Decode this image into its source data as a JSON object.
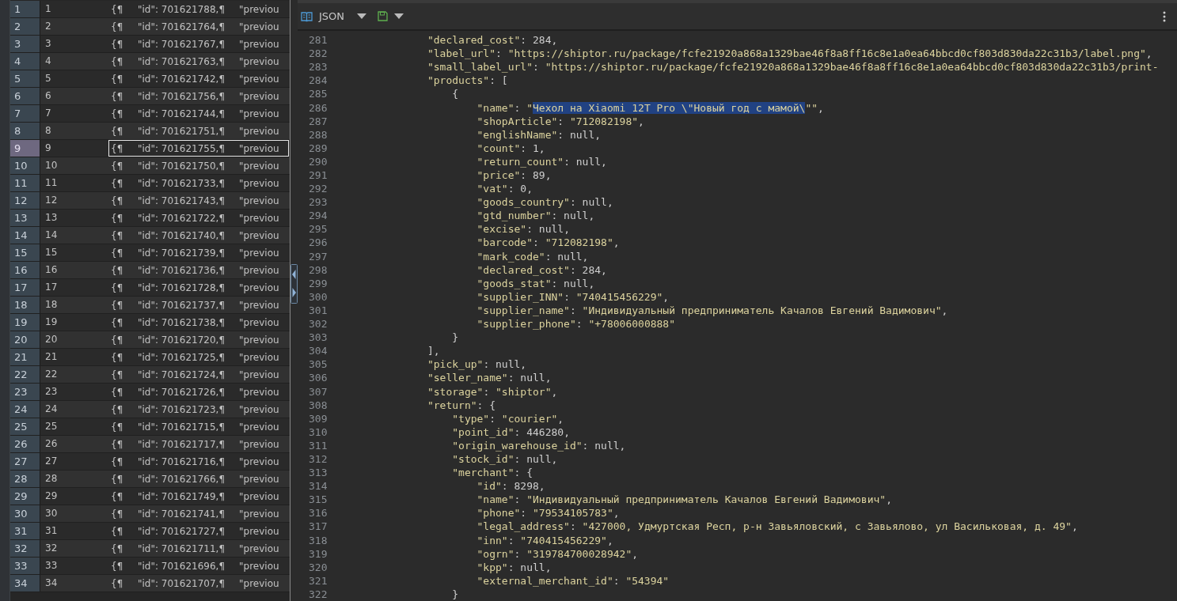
{
  "table": {
    "rows": [
      {
        "header": "1",
        "cells": [
          "1",
          "{¶",
          "\"id\": 701621788,¶",
          "\"previou"
        ],
        "selected": false
      },
      {
        "header": "2",
        "cells": [
          "2",
          "{¶",
          "\"id\": 701621764,¶",
          "\"previou"
        ],
        "selected": false
      },
      {
        "header": "3",
        "cells": [
          "3",
          "{¶",
          "\"id\": 701621767,¶",
          "\"previou"
        ],
        "selected": false
      },
      {
        "header": "4",
        "cells": [
          "4",
          "{¶",
          "\"id\": 701621763,¶",
          "\"previou"
        ],
        "selected": false
      },
      {
        "header": "5",
        "cells": [
          "5",
          "{¶",
          "\"id\": 701621742,¶",
          "\"previou"
        ],
        "selected": false
      },
      {
        "header": "6",
        "cells": [
          "6",
          "{¶",
          "\"id\": 701621756,¶",
          "\"previou"
        ],
        "selected": false
      },
      {
        "header": "7",
        "cells": [
          "7",
          "{¶",
          "\"id\": 701621744,¶",
          "\"previou"
        ],
        "selected": false
      },
      {
        "header": "8",
        "cells": [
          "8",
          "{¶",
          "\"id\": 701621751,¶",
          "\"previou"
        ],
        "selected": false
      },
      {
        "header": "9",
        "cells": [
          "9",
          "{¶",
          "\"id\": 701621755,¶",
          "\"previou"
        ],
        "selected": true
      },
      {
        "header": "10",
        "cells": [
          "10",
          "{¶",
          "\"id\": 701621750,¶",
          "\"previou"
        ],
        "selected": false
      },
      {
        "header": "11",
        "cells": [
          "11",
          "{¶",
          "\"id\": 701621733,¶",
          "\"previou"
        ],
        "selected": false
      },
      {
        "header": "12",
        "cells": [
          "12",
          "{¶",
          "\"id\": 701621743,¶",
          "\"previou"
        ],
        "selected": false
      },
      {
        "header": "13",
        "cells": [
          "13",
          "{¶",
          "\"id\": 701621722,¶",
          "\"previou"
        ],
        "selected": false
      },
      {
        "header": "14",
        "cells": [
          "14",
          "{¶",
          "\"id\": 701621740,¶",
          "\"previou"
        ],
        "selected": false
      },
      {
        "header": "15",
        "cells": [
          "15",
          "{¶",
          "\"id\": 701621739,¶",
          "\"previou"
        ],
        "selected": false
      },
      {
        "header": "16",
        "cells": [
          "16",
          "{¶",
          "\"id\": 701621736,¶",
          "\"previou"
        ],
        "selected": false
      },
      {
        "header": "17",
        "cells": [
          "17",
          "{¶",
          "\"id\": 701621728,¶",
          "\"previou"
        ],
        "selected": false
      },
      {
        "header": "18",
        "cells": [
          "18",
          "{¶",
          "\"id\": 701621737,¶",
          "\"previou"
        ],
        "selected": false
      },
      {
        "header": "19",
        "cells": [
          "19",
          "{¶",
          "\"id\": 701621738,¶",
          "\"previou"
        ],
        "selected": false
      },
      {
        "header": "20",
        "cells": [
          "20",
          "{¶",
          "\"id\": 701621720,¶",
          "\"previou"
        ],
        "selected": false
      },
      {
        "header": "21",
        "cells": [
          "21",
          "{¶",
          "\"id\": 701621725,¶",
          "\"previou"
        ],
        "selected": false
      },
      {
        "header": "22",
        "cells": [
          "22",
          "{¶",
          "\"id\": 701621724,¶",
          "\"previou"
        ],
        "selected": false
      },
      {
        "header": "23",
        "cells": [
          "23",
          "{¶",
          "\"id\": 701621726,¶",
          "\"previou"
        ],
        "selected": false
      },
      {
        "header": "24",
        "cells": [
          "24",
          "{¶",
          "\"id\": 701621723,¶",
          "\"previou"
        ],
        "selected": false
      },
      {
        "header": "25",
        "cells": [
          "25",
          "{¶",
          "\"id\": 701621715,¶",
          "\"previou"
        ],
        "selected": false
      },
      {
        "header": "26",
        "cells": [
          "26",
          "{¶",
          "\"id\": 701621717,¶",
          "\"previou"
        ],
        "selected": false
      },
      {
        "header": "27",
        "cells": [
          "27",
          "{¶",
          "\"id\": 701621716,¶",
          "\"previou"
        ],
        "selected": false
      },
      {
        "header": "28",
        "cells": [
          "28",
          "{¶",
          "\"id\": 701621766,¶",
          "\"previou"
        ],
        "selected": false
      },
      {
        "header": "29",
        "cells": [
          "29",
          "{¶",
          "\"id\": 701621749,¶",
          "\"previou"
        ],
        "selected": false
      },
      {
        "header": "30",
        "cells": [
          "30",
          "{¶",
          "\"id\": 701621741,¶",
          "\"previou"
        ],
        "selected": false
      },
      {
        "header": "31",
        "cells": [
          "31",
          "{¶",
          "\"id\": 701621727,¶",
          "\"previou"
        ],
        "selected": false
      },
      {
        "header": "32",
        "cells": [
          "32",
          "{¶",
          "\"id\": 701621711,¶",
          "\"previou"
        ],
        "selected": false
      },
      {
        "header": "33",
        "cells": [
          "33",
          "{¶",
          "\"id\": 701621696,¶",
          "\"previou"
        ],
        "selected": false
      },
      {
        "header": "34",
        "cells": [
          "34",
          "{¶",
          "\"id\": 701621707,¶",
          "\"previou"
        ],
        "selected": false
      }
    ]
  },
  "editor": {
    "toolbar": {
      "format": "JSON"
    },
    "lines": [
      {
        "number": "281",
        "text": "            \"declared_cost\": 284,"
      },
      {
        "number": "282",
        "text": "            \"label_url\": \"https://shiptor.ru/package/fcfe21920a868a1329bae46f8a8ff16c8e1a0ea64bbcd0cf803d830da22c31b3/label.png\","
      },
      {
        "number": "283",
        "text": "            \"small_label_url\": \"https://shiptor.ru/package/fcfe21920a868a1329bae46f8a8ff16c8e1a0ea64bbcd0cf803d830da22c31b3/print-"
      },
      {
        "number": "284",
        "text": "            \"products\": ["
      },
      {
        "number": "285",
        "text": "                {"
      },
      {
        "number": "286",
        "segments": [
          {
            "text": "                    \"name\": \"",
            "selected": false
          },
          {
            "text": "Чехол на Xiaomi 12T Pro \\\"Новый год с мамой\\",
            "selected": true
          },
          {
            "text": "\"\",",
            "selected": false
          }
        ]
      },
      {
        "number": "287",
        "text": "                    \"shopArticle\": \"712082198\","
      },
      {
        "number": "288",
        "text": "                    \"englishName\": null,"
      },
      {
        "number": "289",
        "text": "                    \"count\": 1,"
      },
      {
        "number": "290",
        "text": "                    \"return_count\": null,"
      },
      {
        "number": "291",
        "text": "                    \"price\": 89,"
      },
      {
        "number": "292",
        "text": "                    \"vat\": 0,"
      },
      {
        "number": "293",
        "text": "                    \"goods_country\": null,"
      },
      {
        "number": "294",
        "text": "                    \"gtd_number\": null,"
      },
      {
        "number": "295",
        "text": "                    \"excise\": null,"
      },
      {
        "number": "296",
        "text": "                    \"barcode\": \"712082198\","
      },
      {
        "number": "297",
        "text": "                    \"mark_code\": null,"
      },
      {
        "number": "298",
        "text": "                    \"declared_cost\": 284,"
      },
      {
        "number": "299",
        "text": "                    \"goods_stat\": null,"
      },
      {
        "number": "300",
        "text": "                    \"supplier_INN\": \"740415456229\","
      },
      {
        "number": "301",
        "text": "                    \"supplier_name\": \"Индивидуальный предприниматель Качалов Евгений Вадимович\","
      },
      {
        "number": "302",
        "text": "                    \"supplier_phone\": \"+78006000888\""
      },
      {
        "number": "303",
        "text": "                }"
      },
      {
        "number": "304",
        "text": "            ],"
      },
      {
        "number": "305",
        "text": "            \"pick_up\": null,"
      },
      {
        "number": "306",
        "text": "            \"seller_name\": null,"
      },
      {
        "number": "307",
        "text": "            \"storage\": \"shiptor\","
      },
      {
        "number": "308",
        "text": "            \"return\": {"
      },
      {
        "number": "309",
        "text": "                \"type\": \"courier\","
      },
      {
        "number": "310",
        "text": "                \"point_id\": 446280,"
      },
      {
        "number": "311",
        "text": "                \"origin_warehouse_id\": null,"
      },
      {
        "number": "312",
        "text": "                \"stock_id\": null,"
      },
      {
        "number": "313",
        "text": "                \"merchant\": {"
      },
      {
        "number": "314",
        "text": "                    \"id\": 8298,"
      },
      {
        "number": "315",
        "text": "                    \"name\": \"Индивидуальный предприниматель Качалов Евгений Вадимович\","
      },
      {
        "number": "316",
        "text": "                    \"phone\": \"79534105783\","
      },
      {
        "number": "317",
        "text": "                    \"legal_address\": \"427000, Удмуртская Респ, р-н Завьяловский, с Завьялово, ул Васильковая, д. 49\","
      },
      {
        "number": "318",
        "text": "                    \"inn\": \"740415456229\","
      },
      {
        "number": "319",
        "text": "                    \"ogrn\": \"319784700028942\","
      },
      {
        "number": "320",
        "text": "                    \"kpp\": null,"
      },
      {
        "number": "321",
        "text": "                    \"external_merchant_id\": \"54394\""
      },
      {
        "number": "322",
        "text": "                }"
      }
    ]
  }
}
